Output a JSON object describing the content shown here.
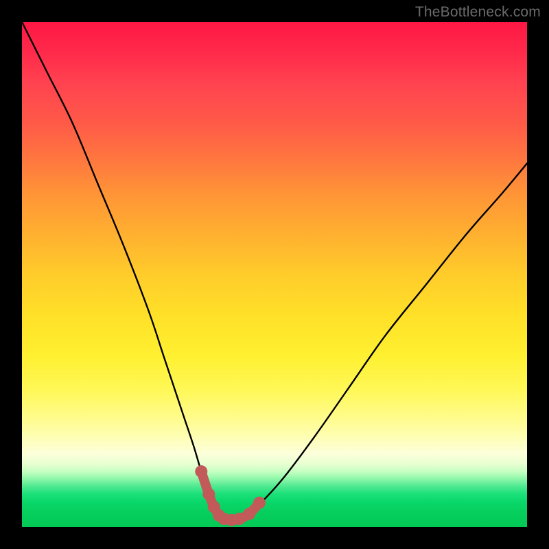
{
  "watermark": {
    "text": "TheBottleneck.com"
  },
  "colors": {
    "frame": "#000000",
    "curve_stroke": "#000000",
    "accent_stroke": "#c35a5a",
    "gradient_top": "#ff1744",
    "gradient_mid": "#ffe028",
    "gradient_bottom": "#03c955"
  },
  "chart_data": {
    "type": "line",
    "title": "",
    "xlabel": "",
    "ylabel": "",
    "xlim": [
      0,
      100
    ],
    "ylim": [
      0,
      100
    ],
    "series": [
      {
        "name": "bottleneck-curve",
        "x": [
          0,
          5,
          10,
          15,
          20,
          25,
          28,
          30,
          32,
          34,
          35.5,
          37,
          38,
          39,
          40,
          41.5,
          43,
          45,
          48,
          52,
          58,
          65,
          72,
          80,
          88,
          95,
          100
        ],
        "y": [
          100,
          90,
          80,
          68,
          56,
          43,
          34,
          28,
          22,
          16,
          11,
          6.5,
          4,
          2.3,
          1.6,
          1.4,
          1.6,
          2.6,
          5.5,
          10,
          18,
          28,
          38,
          48,
          58,
          66,
          72
        ]
      }
    ],
    "accent_points": {
      "name": "bottom-highlight",
      "x": [
        35.5,
        37,
        38,
        39,
        40,
        41.5,
        43,
        45,
        47
      ],
      "y": [
        11,
        6.5,
        4,
        2.3,
        1.6,
        1.4,
        1.6,
        2.6,
        4.8
      ]
    }
  }
}
